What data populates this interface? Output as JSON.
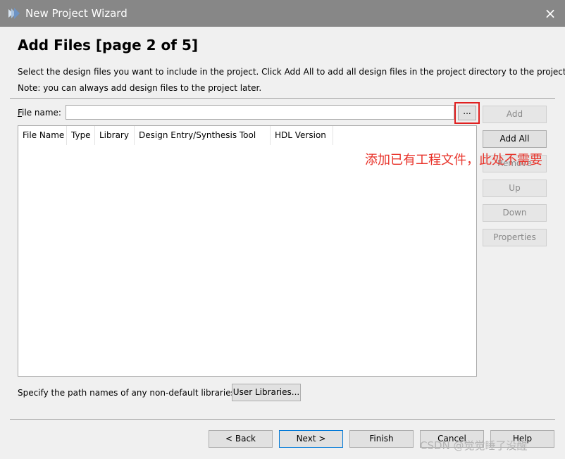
{
  "window": {
    "title": "New Project Wizard",
    "close_glyph": "×",
    "app_icon": "vivado-leaf-icon"
  },
  "page": {
    "title": "Add Files [page 2 of 5]",
    "description": "Select the design files you want to include in the project. Click Add All to add all design files in the project directory to the project.",
    "note": "Note: you can always add design files to the project later."
  },
  "file_name": {
    "label": "File name:",
    "value": "",
    "browse_label": "..."
  },
  "table": {
    "columns": [
      "File Name",
      "Type",
      "Library",
      "Design Entry/Synthesis Tool",
      "HDL Version"
    ],
    "rows": []
  },
  "side_buttons": {
    "add": "Add",
    "add_all": "Add All",
    "remove": "Remove",
    "up": "Up",
    "down": "Down",
    "properties": "Properties"
  },
  "annotation": {
    "text": "添加已有工程文件，此处不需要",
    "color": "#e8332a"
  },
  "libraries": {
    "label": "Specify the path names of any non-default libraries.",
    "button": "User Libraries..."
  },
  "footer": {
    "back": "< Back",
    "next": "Next >",
    "finish": "Finish",
    "cancel": "Cancel",
    "help": "Help"
  },
  "watermark": "CSDN @觉觉睡了没醒"
}
